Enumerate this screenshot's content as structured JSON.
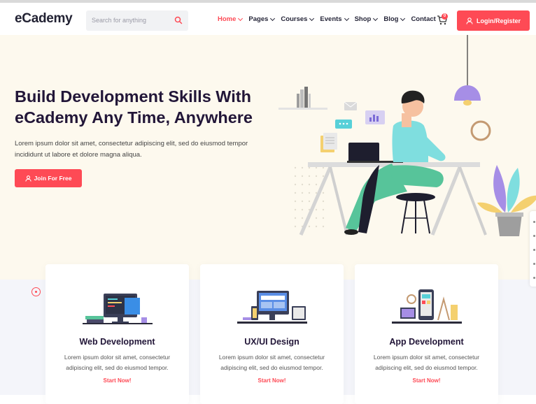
{
  "header": {
    "logo": "eCademy",
    "search_placeholder": "Search for anything",
    "nav": [
      {
        "label": "Home",
        "active": true
      },
      {
        "label": "Pages",
        "active": false
      },
      {
        "label": "Courses",
        "active": false
      },
      {
        "label": "Events",
        "active": false
      },
      {
        "label": "Shop",
        "active": false
      },
      {
        "label": "Blog",
        "active": false
      },
      {
        "label": "Contact",
        "active": false
      }
    ],
    "cart_count": "0",
    "login_label": "Login/Register"
  },
  "hero": {
    "title": "Build Development Skills With eCademy Any Time, Anywhere",
    "text": "Lorem ipsum dolor sit amet, consectetur adipiscing elit, sed do eiusmod tempor incididunt ut labore et dolore magna aliqua.",
    "cta_label": "Join For Free"
  },
  "cards": [
    {
      "title": "Web Development",
      "text": "Lorem ipsum dolor sit amet, consectetur adipiscing elit, sed do eiusmod tempor.",
      "link": "Start Now!"
    },
    {
      "title": "UX/UI Design",
      "text": "Lorem ipsum dolor sit amet, consectetur adipiscing elit, sed do eiusmod tempor.",
      "link": "Start Now!"
    },
    {
      "title": "App Development",
      "text": "Lorem ipsum dolor sit amet, consectetur adipiscing elit, sed do eiusmod tempor.",
      "link": "Start Now!"
    }
  ],
  "colors": {
    "accent": "#fe4a55",
    "hero_bg": "#fdf9ee",
    "heading": "#221638"
  },
  "icons": [
    "search-icon",
    "chevron-down-icon",
    "cart-icon",
    "user-icon"
  ]
}
